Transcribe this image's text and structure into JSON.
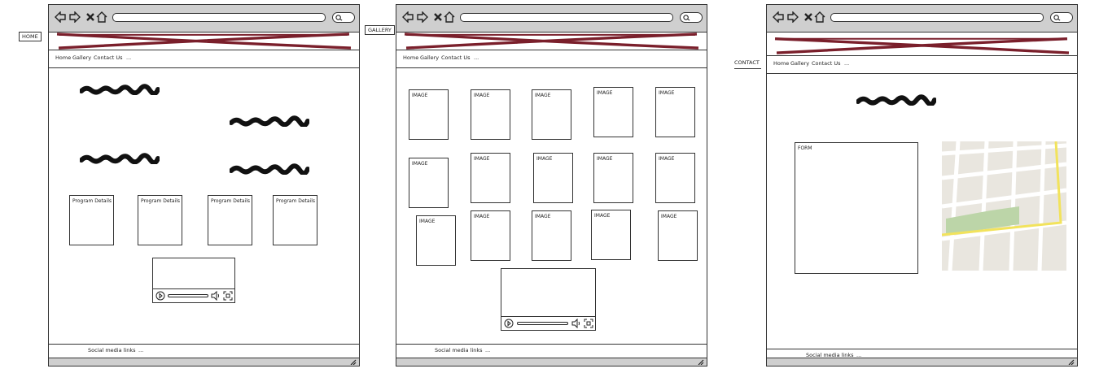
{
  "pages": [
    {
      "page_label": "HOME",
      "nav": {
        "home": "Home",
        "gallery": "Gallery",
        "contact": "Contact Us",
        "more": "..."
      },
      "program_boxes": [
        "Program Details",
        "Program Details",
        "Program Details",
        "Program Details"
      ],
      "footer": {
        "social": "Social media links",
        "more": "..."
      }
    },
    {
      "page_label": "GALLERY",
      "nav": {
        "home": "Home",
        "gallery": "Gallery",
        "contact": "Contact Us",
        "more": "..."
      },
      "image_label": "IMAGE",
      "footer": {
        "social": "Social media links",
        "more": "..."
      }
    },
    {
      "page_label": "CONTACT",
      "nav": {
        "home": "Home",
        "gallery": "Gallery",
        "contact": "Contact Us",
        "more": "..."
      },
      "form_label": "FORM",
      "footer": {
        "social": "Social media links",
        "more": "..."
      }
    }
  ],
  "colors": {
    "banner_cross": "#7a1f2b",
    "chrome": "#cfcfcf",
    "map_park": "#bcd5a8",
    "map_road": "#f2e35c"
  },
  "icons": [
    "back-arrow-icon",
    "forward-arrow-icon",
    "close-icon",
    "home-icon",
    "search-icon",
    "play-icon",
    "volume-icon",
    "fullscreen-icon",
    "resize-grip-icon"
  ]
}
